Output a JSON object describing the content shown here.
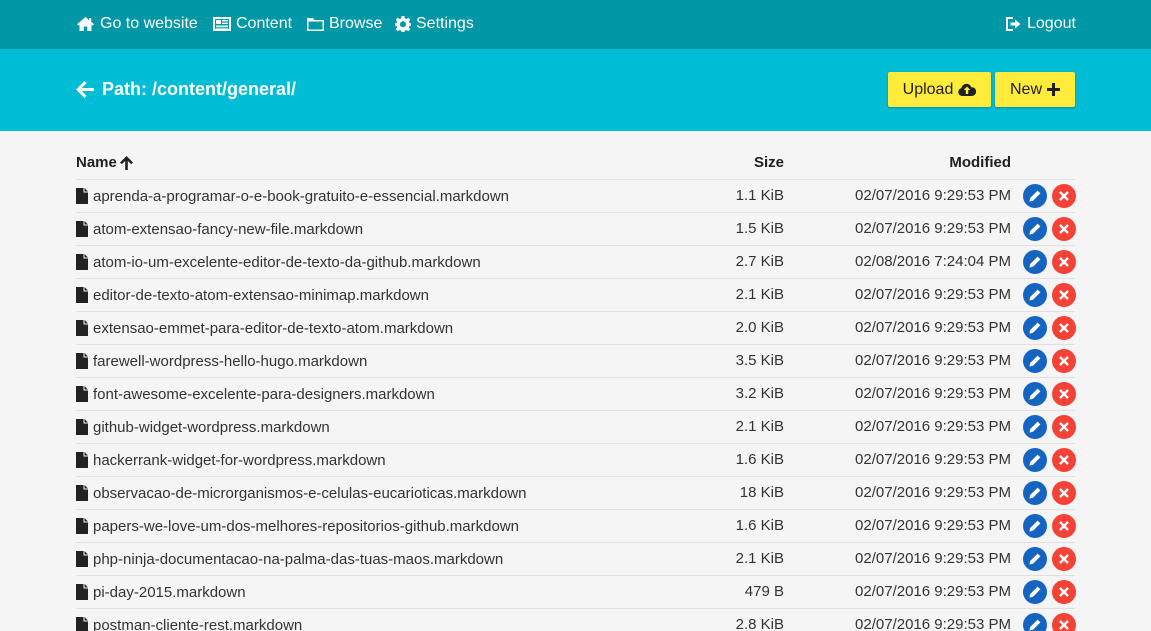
{
  "topnav": {
    "go_to_website": "Go to website",
    "content": "Content",
    "browse": "Browse",
    "settings": "Settings",
    "logout": "Logout"
  },
  "header": {
    "path_label": "Path: /content/general/",
    "upload_label": "Upload",
    "new_label": "New",
    "bar_color": "#00bcd4",
    "topbar_color": "#0097a7",
    "button_color": "#ffeb3b"
  },
  "table": {
    "columns": {
      "name": "Name",
      "size": "Size",
      "modified": "Modified"
    },
    "sort_indicator": "arrow-up-icon",
    "rows": [
      {
        "name": "aprenda-a-programar-o-e-book-gratuito-e-essencial.markdown",
        "size": "1.1 KiB",
        "modified": "02/07/2016 9:29:53 PM"
      },
      {
        "name": "atom-extensao-fancy-new-file.markdown",
        "size": "1.5 KiB",
        "modified": "02/07/2016 9:29:53 PM"
      },
      {
        "name": "atom-io-um-excelente-editor-de-texto-da-github.markdown",
        "size": "2.7 KiB",
        "modified": "02/08/2016 7:24:04 PM"
      },
      {
        "name": "editor-de-texto-atom-extensao-minimap.markdown",
        "size": "2.1 KiB",
        "modified": "02/07/2016 9:29:53 PM"
      },
      {
        "name": "extensao-emmet-para-editor-de-texto-atom.markdown",
        "size": "2.0 KiB",
        "modified": "02/07/2016 9:29:53 PM"
      },
      {
        "name": "farewell-wordpress-hello-hugo.markdown",
        "size": "3.5 KiB",
        "modified": "02/07/2016 9:29:53 PM"
      },
      {
        "name": "font-awesome-excelente-para-designers.markdown",
        "size": "3.2 KiB",
        "modified": "02/07/2016 9:29:53 PM"
      },
      {
        "name": "github-widget-wordpress.markdown",
        "size": "2.1 KiB",
        "modified": "02/07/2016 9:29:53 PM"
      },
      {
        "name": "hackerrank-widget-for-wordpress.markdown",
        "size": "1.6 KiB",
        "modified": "02/07/2016 9:29:53 PM"
      },
      {
        "name": "observacao-de-microrganismos-e-celulas-eucarioticas.markdown",
        "size": "18 KiB",
        "modified": "02/07/2016 9:29:53 PM"
      },
      {
        "name": "papers-we-love-um-dos-melhores-repositorios-github.markdown",
        "size": "1.6 KiB",
        "modified": "02/07/2016 9:29:53 PM"
      },
      {
        "name": "php-ninja-documentacao-na-palma-das-tuas-maos.markdown",
        "size": "2.1 KiB",
        "modified": "02/07/2016 9:29:53 PM"
      },
      {
        "name": "pi-day-2015.markdown",
        "size": "479 B",
        "modified": "02/07/2016 9:29:53 PM"
      },
      {
        "name": "postman-cliente-rest.markdown",
        "size": "2.8 KiB",
        "modified": "02/07/2016 9:29:53 PM"
      }
    ],
    "edit_color": "#1565c0",
    "delete_color": "#f44336"
  }
}
